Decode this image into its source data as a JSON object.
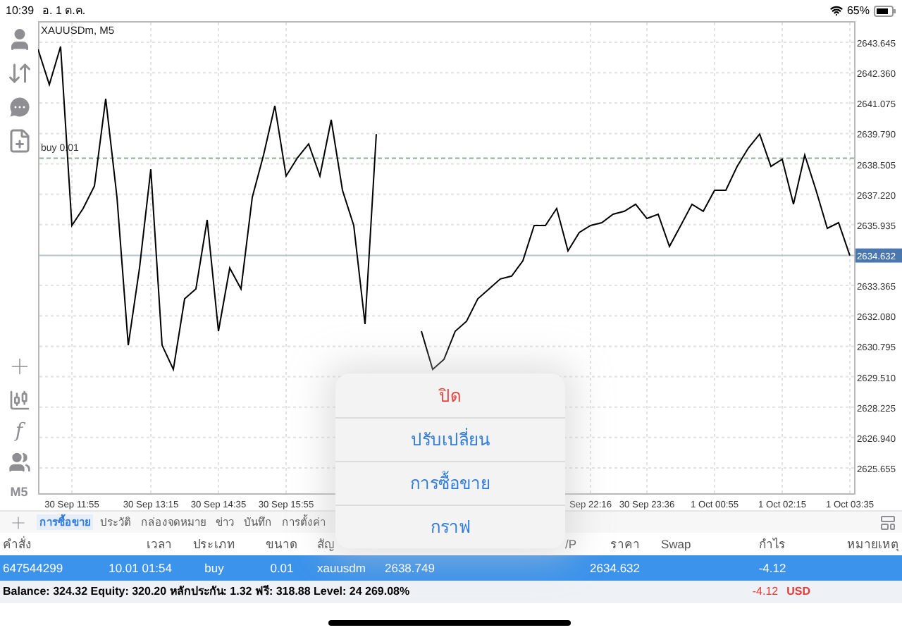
{
  "status_bar": {
    "time": "10:39",
    "date": "อ. 1 ต.ค.",
    "battery": "65%"
  },
  "toolbar": {
    "top": [
      {
        "kind": "person"
      },
      {
        "kind": "trade"
      },
      {
        "kind": "chat"
      },
      {
        "kind": "new"
      }
    ],
    "bottom": [
      {
        "kind": "crosshair"
      },
      {
        "kind": "candles"
      },
      {
        "kind": "function",
        "text": "f"
      },
      {
        "kind": "people"
      },
      {
        "kind": "period",
        "text": "M5"
      }
    ]
  },
  "chart": {
    "title": "XAUUSDm, M5",
    "chart_data": {
      "type": "line",
      "grid": true,
      "ylim": [
        2624.58,
        2644.54
      ],
      "categories": [
        null,
        null,
        null,
        "30 Sep 11:55",
        null,
        null,
        null,
        null,
        null,
        null,
        "30 Sep 13:15",
        null,
        null,
        null,
        null,
        null,
        "30 Sep 14:35",
        null,
        null,
        null,
        null,
        null,
        "30 Sep 15:55",
        null,
        null,
        null,
        null,
        null,
        null,
        null,
        null,
        null,
        null,
        null,
        null,
        null,
        null,
        null,
        null,
        null,
        null,
        null,
        null,
        null,
        null,
        null,
        null,
        null,
        null,
        "Sep 22:16",
        null,
        null,
        null,
        null,
        "30 Sep 23:36",
        null,
        null,
        null,
        null,
        null,
        "1 Oct 00:55",
        null,
        null,
        null,
        null,
        null,
        "1 Oct 02:15",
        null,
        null,
        null,
        null,
        null,
        "1 Oct 03:35"
      ],
      "yticks": [
        {
          "value": 2643.645,
          "label": "2643.645"
        },
        {
          "value": 2642.36,
          "label": "2642.360"
        },
        {
          "value": 2641.075,
          "label": "2641.075"
        },
        {
          "value": 2639.79,
          "label": "2639.790"
        },
        {
          "value": 2638.505,
          "label": "2638.505"
        },
        {
          "value": 2637.22,
          "label": "2637.220"
        },
        {
          "value": 2635.935,
          "label": "2635.935"
        },
        {
          "value": 2633.365,
          "label": "2633.365"
        },
        {
          "value": 2632.08,
          "label": "2632.080"
        },
        {
          "value": 2630.795,
          "label": "2630.795"
        },
        {
          "value": 2629.51,
          "label": "2629.510"
        },
        {
          "value": 2628.225,
          "label": "2628.225"
        },
        {
          "value": 2626.94,
          "label": "2626.940"
        },
        {
          "value": 2625.655,
          "label": "2625.655"
        }
      ],
      "series": [
        {
          "color": "#000000",
          "values": [
            2643.35,
            2641.86,
            2643.47,
            2635.9,
            2636.62,
            2637.57,
            2641.26,
            2637.09,
            2630.84,
            2634.11,
            2638.28,
            2630.84,
            2629.82,
            2632.8,
            2633.22,
            2636.14,
            2631.43,
            2634.11,
            2633.22,
            2637.09,
            2638.88,
            2640.96,
            2637.99,
            2638.76,
            2639.35,
            2637.99,
            2640.37,
            2637.39,
            2635.9,
            2631.73,
            2639.77,
            null,
            null,
            null,
            2631.43,
            2629.82,
            2630.24,
            2631.43,
            2631.85,
            2632.8,
            2633.22,
            2633.64,
            2633.76,
            2634.41,
            2635.9,
            2635.9,
            2636.62,
            2634.83,
            2635.6,
            2635.9,
            2636.02,
            2636.38,
            2636.5,
            2636.8,
            2636.2,
            2636.38,
            2635.01,
            2635.9,
            2636.8,
            2636.5,
            2637.39,
            2637.39,
            2638.4,
            2639.18,
            2639.77,
            2638.4,
            2638.7,
            2636.8,
            2638.88,
            2637.39,
            2635.78,
            2636.02,
            2634.63
          ]
        }
      ],
      "ref_lines": [
        {
          "axis": "y",
          "value": 2638.749,
          "label": "buy 0.01",
          "color": "#8fb08f"
        },
        {
          "axis": "y",
          "value": 2634.632,
          "label": "2634.632",
          "color": "#b7c3d4"
        }
      ]
    }
  },
  "tabs": [
    {
      "label": "การซื้อขาย",
      "selected": true
    },
    {
      "label": "ประวัติ",
      "selected": false
    },
    {
      "label": "กล่องจดหมาย",
      "selected": false
    },
    {
      "label": "ข่าว",
      "selected": false
    },
    {
      "label": "บันทึก",
      "selected": false
    },
    {
      "label": "การตั้งค่า",
      "selected": false
    }
  ],
  "table": {
    "columns": [
      "คำสั่ง",
      "เวลา",
      "ประเภท",
      "ขนาด",
      "สัญ",
      "",
      "",
      "/P",
      "ราคา",
      "Swap",
      "กำไร",
      "หมายเหตุ"
    ],
    "rows": [
      {
        "selected": true,
        "cells": [
          "647544299",
          "10.01 01:54",
          "buy",
          "0.01",
          "xauusdm",
          "2638.749",
          "",
          "",
          "2634.632",
          "",
          "-4.12",
          ""
        ]
      }
    ]
  },
  "summary": {
    "text": "Balance: 324.32 Equity: 320.20 หลักประกัน: 1.32 ฟรี: 318.88 Level: 24 269.08%",
    "profit": "-4.12",
    "currency": "USD"
  },
  "menu": {
    "items": [
      {
        "label": "ปิด",
        "kind": "destructive"
      },
      {
        "label": "ปรับเปลี่ยน",
        "kind": "action"
      },
      {
        "label": "การซื้อขาย",
        "kind": "action"
      },
      {
        "label": "กราฟ",
        "kind": "action"
      }
    ]
  }
}
